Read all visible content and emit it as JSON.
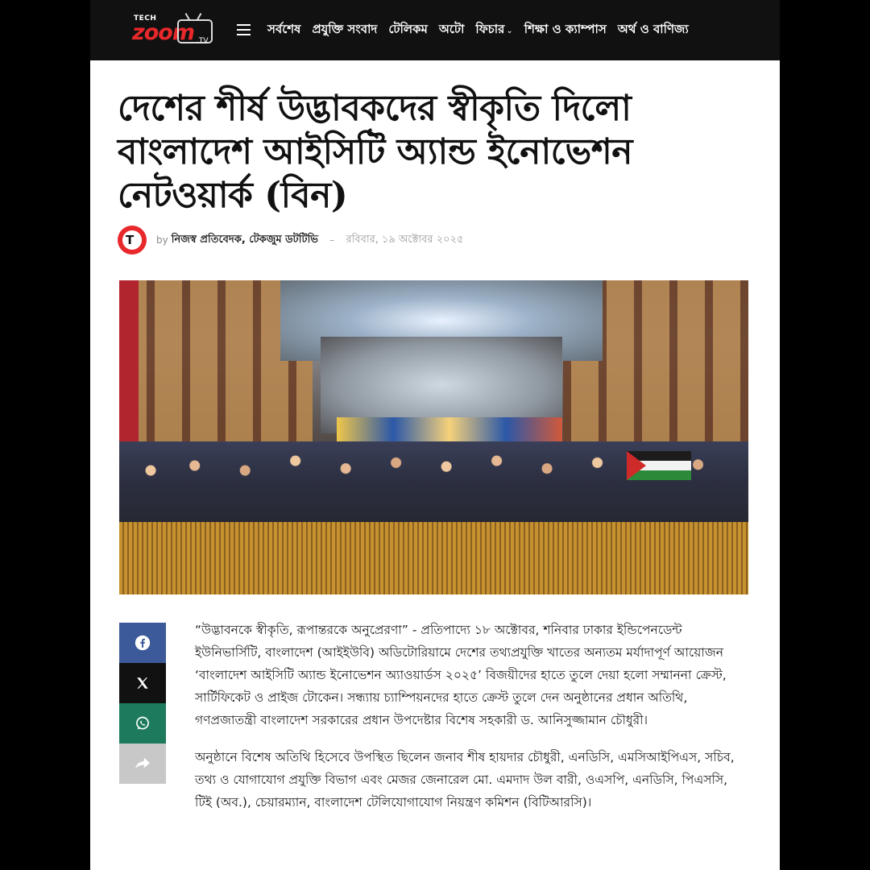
{
  "header": {
    "logo": {
      "tech": "TECH",
      "zoom": "zoom",
      "tv": ".TV",
      "icon": "tv-logo-icon"
    },
    "menu_icon": "hamburger-menu-icon",
    "nav": [
      {
        "label": "সর্বশেষ"
      },
      {
        "label": "প্রযুক্তি সংবাদ"
      },
      {
        "label": "টেলিকম"
      },
      {
        "label": "অটো"
      },
      {
        "label": "ফিচার",
        "has_dropdown": true,
        "icon": "chevron-down-icon"
      },
      {
        "label": "শিক্ষা ও ক্যাম্পাস"
      },
      {
        "label": "অর্থ ও বাণিজ্য"
      }
    ]
  },
  "article": {
    "title": "দেশের শীর্ষ উদ্ভাবকদের স্বীকৃতি দিলো বাংলাদেশ আইসিটি অ্যান্ড ইনোভেশন নেটওয়ার্ক (বিন)",
    "byline": {
      "by": "by",
      "author": "নিজস্ব প্রতিবেদক, টেকজুম ডটটিভি",
      "separator": "–",
      "date": "রবিবার, ১৯ অক্টোবর ২০২৫"
    },
    "paragraphs": [
      "“উদ্ভাবনকে স্বীকৃতি, রূপান্তরকে অনুপ্রেরণা” - প্রতিপাদ্যে ১৮ অক্টোবর, শনিবার ঢাকার ইন্ডিপেনডেন্ট ইউনিভার্সিটি, বাংলাদেশ (আইইউবি) অডিটোরিয়ামে দেশের তথ্যপ্রযুক্তি খাতের অন্যতম মর্যাদাপূর্ণ আয়োজন ‘বাংলাদেশ আইসিটি অ্যান্ড ইনোভেশন অ্যাওয়ার্ডস ২০২৫’ বিজয়ীদের হাতে তুলে দেয়া হলো সম্মাননা ক্রেস্ট, সার্টিফিকেট ও প্রাইজ টোকেন। সন্ধ্যায় চ্যাম্পিয়নদের হাতে ক্রেস্ট তুলে দেন অনুষ্ঠানের প্রধান অতিথি, গণপ্রজাতন্ত্রী বাংলাদেশ সরকারের প্রধান উপদেষ্টার বিশেষ সহকারী ড. আনিসুজ্জামান চৌধুরী।",
      "অনুষ্ঠানে বিশেষ অতিথি হিসেবে উপস্থিত ছিলেন জনাব শীষ হায়দার চৌধুরী, এনডিসি, এমসিআইপিএস, সচিব, তথ্য ও যোগাযোগ প্রযুক্তি বিভাগ এবং মেজর জেনারেল মো. এমদাদ উল বারী, ওএসপি, এনডিসি, পিএসসি, টিই (অব.), চেয়ারম্যান, বাংলাদেশ টেলিযোগাযোগ নিয়ন্ত্রণ কমিশন (বিটিআরসি)।"
    ]
  },
  "share": [
    {
      "name": "facebook",
      "icon": "facebook-icon",
      "color": "#3c5a99"
    },
    {
      "name": "x",
      "icon": "x-icon",
      "color": "#111111"
    },
    {
      "name": "whatsapp",
      "icon": "whatsapp-icon",
      "color": "#1d7a5c"
    },
    {
      "name": "more",
      "icon": "share-arrow-icon",
      "color": "#c8c8c8"
    }
  ],
  "colors": {
    "brand": "#e8282b",
    "header_bg": "#111111"
  }
}
